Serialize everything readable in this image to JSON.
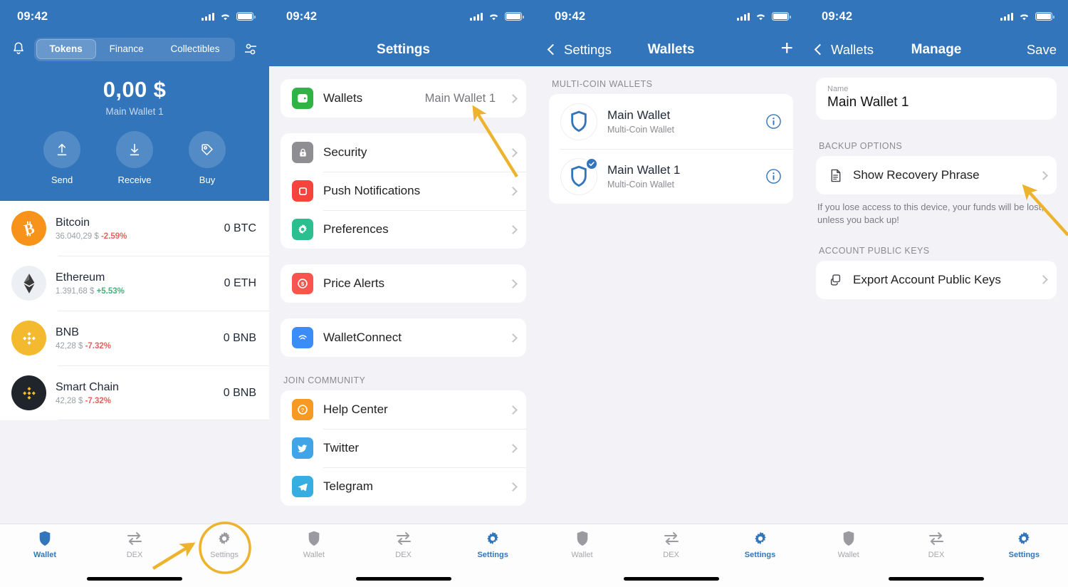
{
  "meta": {
    "accent_blue": "#3375BB",
    "annotation_color": "#EDB32E",
    "bg_grouped": "#F2F2F7"
  },
  "status_bar": {
    "time": "09:42"
  },
  "panel_wallet": {
    "header": {
      "bell_icon": "bell-icon",
      "filter_icon": "filter-sliders-icon",
      "tabs": [
        {
          "label": "Tokens",
          "active": true
        },
        {
          "label": "Finance",
          "active": false
        },
        {
          "label": "Collectibles",
          "active": false
        }
      ],
      "balance": "0,00 $",
      "wallet_name": "Main Wallet 1",
      "actions": [
        {
          "label": "Send",
          "icon": "upload-arrow-icon"
        },
        {
          "label": "Receive",
          "icon": "download-arrow-icon"
        },
        {
          "label": "Buy",
          "icon": "price-tag-icon"
        }
      ]
    },
    "tokens": [
      {
        "name": "Bitcoin",
        "price": "36.040,29 $",
        "change": "-2.59%",
        "change_dir": "neg",
        "amount": "0 BTC",
        "icon": "bitcoin-icon"
      },
      {
        "name": "Ethereum",
        "price": "1.391,68 $",
        "change": "+5.53%",
        "change_dir": "pos",
        "amount": "0 ETH",
        "icon": "ethereum-icon"
      },
      {
        "name": "BNB",
        "price": "42,28 $",
        "change": "-7.32%",
        "change_dir": "neg",
        "amount": "0 BNB",
        "icon": "bnb-icon"
      },
      {
        "name": "Smart Chain",
        "price": "42,28 $",
        "change": "-7.32%",
        "change_dir": "neg",
        "amount": "0 BNB",
        "icon": "smartchain-icon"
      }
    ]
  },
  "panel_settings": {
    "title": "Settings",
    "groups": [
      {
        "header": "",
        "rows": [
          {
            "label": "Wallets",
            "value": "Main Wallet 1",
            "icon": "wallet-icon",
            "icon_color": "#2FB344"
          }
        ]
      },
      {
        "header": "",
        "rows": [
          {
            "label": "Security",
            "value": "",
            "icon": "lock-icon",
            "icon_color": "#8E8E93"
          },
          {
            "label": "Push Notifications",
            "value": "",
            "icon": "bell-square-icon",
            "icon_color": "#F6443C"
          },
          {
            "label": "Preferences",
            "value": "",
            "icon": "gear-icon",
            "icon_color": "#2BBF8F"
          }
        ]
      },
      {
        "header": "",
        "rows": [
          {
            "label": "Price Alerts",
            "value": "",
            "icon": "dollar-icon",
            "icon_color": "#F9554E"
          }
        ]
      },
      {
        "header": "",
        "rows": [
          {
            "label": "WalletConnect",
            "value": "",
            "icon": "walletconnect-icon",
            "icon_color": "#3B8CF7"
          }
        ]
      },
      {
        "header": "JOIN COMMUNITY",
        "rows": [
          {
            "label": "Help Center",
            "value": "",
            "icon": "question-icon",
            "icon_color": "#F79A23"
          },
          {
            "label": "Twitter",
            "value": "",
            "icon": "twitter-icon",
            "icon_color": "#41A4E6"
          },
          {
            "label": "Telegram",
            "value": "",
            "icon": "telegram-icon",
            "icon_color": "#37AEE2"
          }
        ]
      }
    ]
  },
  "panel_wallets": {
    "back_label": "Settings",
    "title": "Wallets",
    "add_icon": "plus-icon",
    "group_header": "MULTI-COIN WALLETS",
    "wallets": [
      {
        "name": "Main Wallet",
        "subtitle": "Multi-Coin Wallet",
        "selected": false,
        "info_icon": "info-icon"
      },
      {
        "name": "Main Wallet 1",
        "subtitle": "Multi-Coin Wallet",
        "selected": true,
        "info_icon": "info-icon"
      }
    ]
  },
  "panel_manage": {
    "back_label": "Wallets",
    "title": "Manage",
    "save_label": "Save",
    "name_field": {
      "label": "Name",
      "value": "Main Wallet 1"
    },
    "backup": {
      "header": "BACKUP OPTIONS",
      "row_label": "Show Recovery Phrase",
      "row_icon": "document-icon",
      "note": "If you lose access to this device, your funds will be lost, unless you back up!"
    },
    "public_keys": {
      "header": "ACCOUNT PUBLIC KEYS",
      "row_label": "Export Account Public Keys",
      "row_icon": "copy-icon"
    }
  },
  "tabbar": {
    "tabs": [
      {
        "label": "Wallet",
        "icon": "shield-icon"
      },
      {
        "label": "DEX",
        "icon": "swap-arrows-icon"
      },
      {
        "label": "Settings",
        "icon": "gear-icon"
      }
    ],
    "active_wallet_panel": "Wallet",
    "active_other_panels": "Settings"
  },
  "annotations": [
    {
      "name": "highlight-circle-settings-tab",
      "shape": "circle"
    },
    {
      "name": "arrow-to-settings-tab",
      "shape": "arrow"
    },
    {
      "name": "arrow-to-wallets-row",
      "shape": "arrow"
    },
    {
      "name": "arrow-to-show-recovery-phrase",
      "shape": "arrow"
    }
  ]
}
